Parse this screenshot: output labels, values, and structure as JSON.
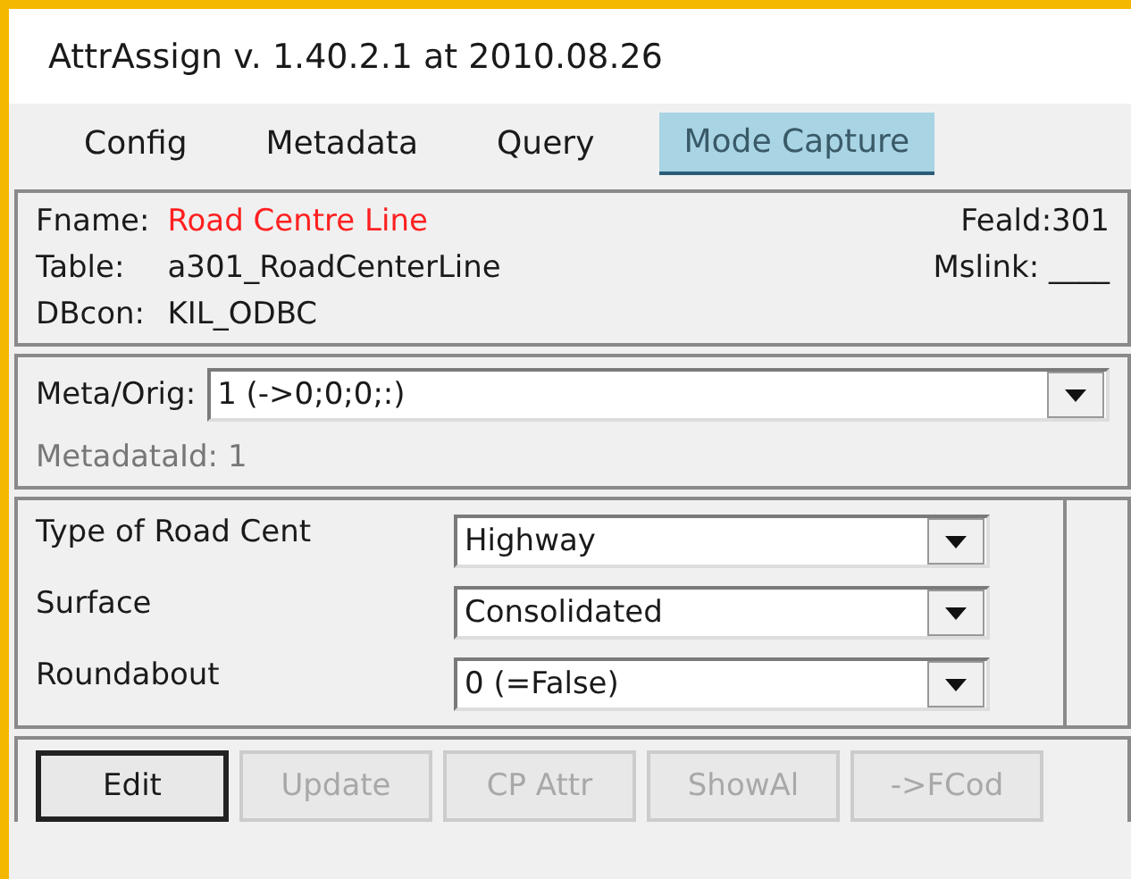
{
  "window": {
    "title": "AttrAssign v. 1.40.2.1 at 2010.08.26"
  },
  "menu": [
    {
      "label": "Config",
      "selected": false
    },
    {
      "label": "Metadata",
      "selected": false
    },
    {
      "label": "Query",
      "selected": false
    },
    {
      "label": "Mode Capture",
      "selected": true
    }
  ],
  "feature": {
    "fname_label": "Fname:",
    "fname": "Road Centre Line",
    "feald_label": "Feald:",
    "feald": "301",
    "table_label": "Table:",
    "table": "a301_RoadCenterLine",
    "mslink_label": "Mslink:",
    "mslink": "____",
    "dbcon_label": "DBcon:",
    "dbcon": "KIL_ODBC"
  },
  "meta": {
    "label": "Meta/Orig:",
    "value": "1  (->0;0;0;:)",
    "id_label": "MetadataId:",
    "id": "1"
  },
  "attributes": [
    {
      "label": "Type of Road Cent",
      "value": "Highway"
    },
    {
      "label": "Surface",
      "value": "Consolidated"
    },
    {
      "label": "Roundabout",
      "value": "0  (=False)"
    }
  ],
  "buttons": [
    {
      "label": "Edit",
      "disabled": false
    },
    {
      "label": "Update",
      "disabled": true
    },
    {
      "label": "CP Attr",
      "disabled": true
    },
    {
      "label": "ShowAl",
      "disabled": true
    },
    {
      "label": "->FCod",
      "disabled": true
    }
  ]
}
